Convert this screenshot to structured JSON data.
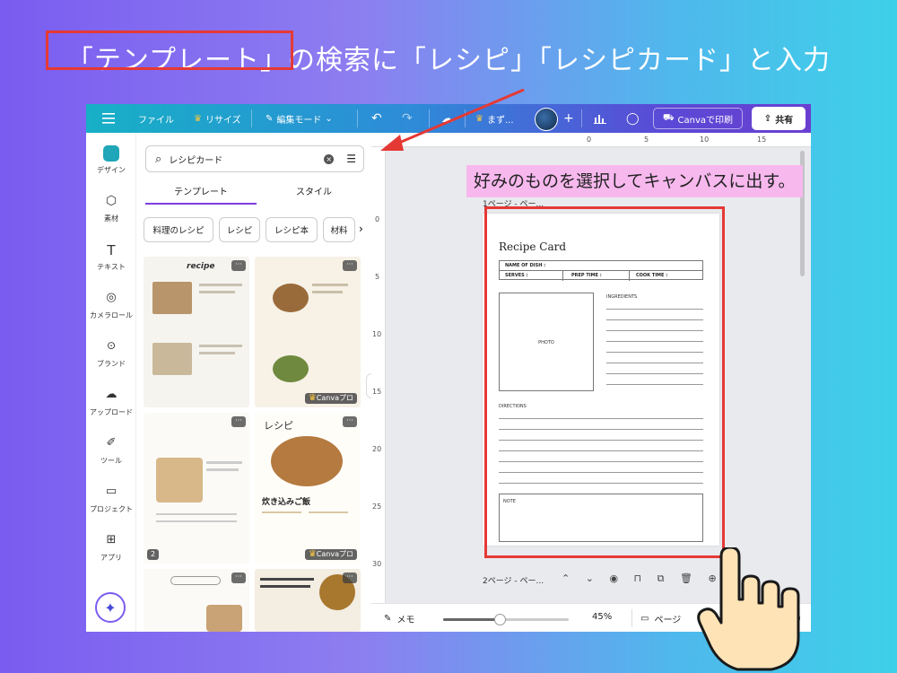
{
  "caption": "「テンプレート」の検索に「レシピ」「レシピカード」と入力",
  "annotation": "好みのものを選択してキャンバスに出す。",
  "topbar": {
    "file": "ファイル",
    "resize": "リサイズ",
    "edit_mode": "編集モード",
    "doc_title": "まず...",
    "print": "Canvaで印刷",
    "share": "共有"
  },
  "rail": {
    "design": "デザイン",
    "elements": "素材",
    "text": "テキスト",
    "camera_roll": "カメラロール",
    "brand": "ブランド",
    "upload": "アップロード",
    "tools": "ツール",
    "projects": "プロジェクト",
    "apps": "アプリ"
  },
  "search": {
    "value": "レシピカード"
  },
  "tabs": {
    "templates": "テンプレート",
    "styles": "スタイル"
  },
  "chips": [
    "料理のレシピ",
    "レシピ",
    "レシピ本",
    "材料"
  ],
  "thumbnails": {
    "t1_title": "recipe",
    "t2_pro": "Canvaプロ",
    "t4_count": "2",
    "t5_title": "レシピ",
    "t5_sub": "炊き込みご飯",
    "t5_pro": "Canvaプロ"
  },
  "ruler": {
    "top": [
      "0",
      "5",
      "10",
      "15"
    ],
    "left": [
      "0",
      "5",
      "10",
      "15",
      "20",
      "25",
      "30"
    ]
  },
  "pages": {
    "page1_label": "1ページ - ペー...",
    "page2_label": "2ページ - ペー..."
  },
  "recipe_card": {
    "title": "Recipe Card",
    "name_of_dish": "NAME OF DISH :",
    "serves": "SERVES :",
    "prep_time": "PREP TIME :",
    "cook_time": "COOK TIME :",
    "photo": "PHOTO",
    "ingredients": "INGREDIENTS",
    "directions": "DIRECTIONS",
    "note": "NOTE"
  },
  "bottombar": {
    "notes": "メモ",
    "zoom": "45%",
    "zoom_fraction": 0.45,
    "pages": "ページ",
    "help": "?"
  },
  "colors": {
    "highlight_red": "#e53935",
    "annotation_pink": "#f7b8ee",
    "active_tab": "#7b3fe0"
  }
}
